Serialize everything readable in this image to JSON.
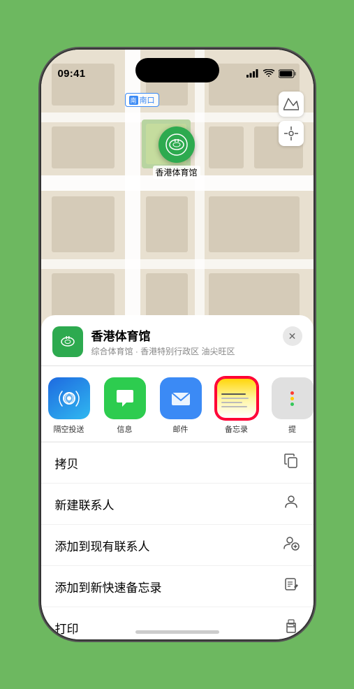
{
  "status_bar": {
    "time": "09:41",
    "location_icon": "▶",
    "signal": "▐▐▐▐",
    "wifi": "wifi",
    "battery": "battery"
  },
  "map": {
    "south_gate_label": "南口",
    "venue_name_pin": "香港体育馆",
    "controls": {
      "map_icon": "🗺",
      "location_icon": "⊕"
    }
  },
  "venue_card": {
    "name": "香港体育馆",
    "subtitle": "综合体育馆 · 香港特别行政区 油尖旺区",
    "close_label": "✕"
  },
  "share_items": [
    {
      "id": "airdrop",
      "label": "隔空投送",
      "icon": "📡"
    },
    {
      "id": "messages",
      "label": "信息",
      "icon": "💬"
    },
    {
      "id": "mail",
      "label": "邮件",
      "icon": "✉"
    },
    {
      "id": "notes",
      "label": "备忘录",
      "icon": "notes"
    },
    {
      "id": "more",
      "label": "提",
      "icon": "···"
    }
  ],
  "actions": [
    {
      "label": "拷贝",
      "icon": "copy"
    },
    {
      "label": "新建联系人",
      "icon": "person"
    },
    {
      "label": "添加到现有联系人",
      "icon": "person-add"
    },
    {
      "label": "添加到新快速备忘录",
      "icon": "note"
    },
    {
      "label": "打印",
      "icon": "print"
    }
  ]
}
